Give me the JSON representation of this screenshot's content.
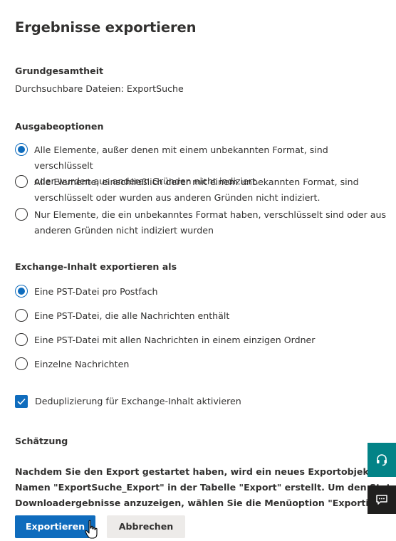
{
  "panel": {
    "title": "Ergebnisse exportieren"
  },
  "population": {
    "label": "Grundgesamtheit",
    "value": "Durchsuchbare Dateien: ExportSuche"
  },
  "output_options": {
    "label": "Ausgabeoptionen",
    "selected_index": 0,
    "options": [
      {
        "line1": "Alle Elemente, außer denen mit einem unbekannten Format, sind verschlüsselt",
        "line2": "oder wurden aus anderen Gründen nicht indiziert."
      },
      {
        "line1": "Alle Elemente, einschließlich derer mit einem unbekannten Format, sind",
        "line2": "verschlüsselt oder wurden aus anderen Gründen nicht indiziert."
      },
      {
        "line1": "Nur Elemente, die ein unbekanntes Format haben, verschlüsselt sind oder aus",
        "line2": "anderen Gründen nicht indiziert wurden"
      }
    ]
  },
  "exchange_export": {
    "label": "Exchange-Inhalt exportieren als",
    "selected_index": 0,
    "options": [
      "Eine PST-Datei pro Postfach",
      "Eine PST-Datei, die alle Nachrichten enthält",
      "Eine PST-Datei mit allen Nachrichten in einem einzigen Ordner",
      "Einzelne Nachrichten"
    ]
  },
  "dedup": {
    "label": "Deduplizierung für Exchange-Inhalt aktivieren",
    "checked": true
  },
  "estimate": {
    "label": "Schätzung",
    "lines": [
      "Nachdem Sie den Export gestartet haben, wird ein neues Exportobjekt mit dem",
      "Namen \"ExportSuche_Export\" in der Tabelle \"Export\" erstellt. Um den Status und",
      "Downloadergebnisse anzuzeigen, wählen Sie die Menüoption \"Exportieren\" aus."
    ]
  },
  "buttons": {
    "export": "Exportieren",
    "cancel": "Abbrechen"
  },
  "icons": {
    "help": "help-headset-icon",
    "feedback": "feedback-chat-icon"
  },
  "colors": {
    "accent": "#0f6cbd",
    "teal": "#038387",
    "dark": "#201f1e",
    "text": "#323130"
  }
}
